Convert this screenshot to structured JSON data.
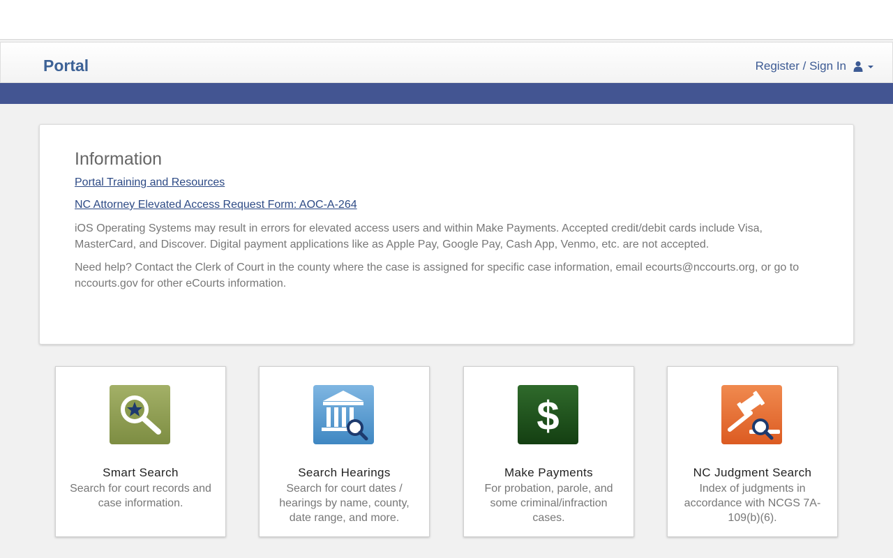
{
  "header": {
    "brand": "Portal",
    "signin_label": "Register / Sign In",
    "user_icon": "user-icon",
    "accent_color": "#435592"
  },
  "information": {
    "title": "Information",
    "links": [
      "Portal Training and Resources",
      "NC Attorney Elevated Access Request Form: AOC-A-264"
    ],
    "paragraphs": [
      "iOS Operating Systems may result in errors for elevated access users and within Make Payments. Accepted credit/debit cards include Visa, MasterCard, and Discover. Digital payment applications like as Apple Pay, Google Pay, Cash App, Venmo, etc. are not accepted.",
      "Need help? Contact the Clerk of Court in the county where the case is assigned for specific case information, email ecourts@nccourts.org, or go to nccourts.gov for other eCourts information."
    ]
  },
  "tiles": [
    {
      "title": "Smart Search",
      "description": "Search for court records and case information.",
      "icon": "magnifier-star-icon",
      "color": "#8a9a4e"
    },
    {
      "title": "Search Hearings",
      "description": "Search for court dates / hearings by name, county, date range, and more.",
      "icon": "courthouse-search-icon",
      "color": "#4f93c9"
    },
    {
      "title": "Make Payments",
      "description": "For probation, parole, and some criminal/infraction cases.",
      "icon": "dollar-icon",
      "color": "#1f4d1c"
    },
    {
      "title": "NC Judgment Search",
      "description": "Index of judgments in accordance with NCGS 7A-109(b)(6).",
      "icon": "gavel-search-icon",
      "color": "#e2672b"
    }
  ]
}
